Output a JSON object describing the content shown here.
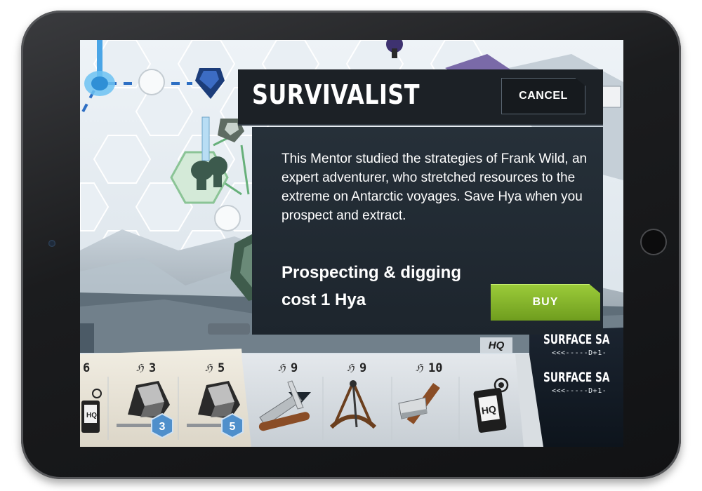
{
  "dialog": {
    "title": "SURVIVALIST",
    "cancel_label": "CANCEL",
    "description": "This Mentor studied the strategies of Frank Wild, an expert adventurer, who stretched resources to the extreme on Antarctic voyages. Save Hya when you prospect and extract.",
    "effect_line1": "Prospecting & digging",
    "effect_line2": "cost 1 Hya",
    "buy_label": "BUY"
  },
  "shop": {
    "hq_label": "HQ",
    "currency_glyph": "ℌ",
    "items": [
      {
        "name": "hq-radio-partial",
        "price": "6",
        "icon": "radio-icon"
      },
      {
        "name": "ore-crystal-level-3",
        "price": "3",
        "icon": "ore-icon",
        "level": "3"
      },
      {
        "name": "ore-crystal-level-5",
        "price": "5",
        "icon": "ore-icon",
        "level": "5"
      },
      {
        "name": "pocket-knife",
        "price": "9",
        "icon": "knife-icon"
      },
      {
        "name": "sextant",
        "price": "9",
        "icon": "sextant-icon"
      },
      {
        "name": "hammer",
        "price": "10",
        "icon": "hammer-icon"
      },
      {
        "name": "hq-radio",
        "price": "",
        "icon": "radio-icon"
      }
    ]
  },
  "surface": {
    "label_1": "SURFACE SA",
    "track_1": "<<<-----D+1-",
    "label_2": "SURFACE SA",
    "track_2": "<<<-----D+1-"
  },
  "colors": {
    "dialog_bg": "#1d252d",
    "buy_green": "#86b52c",
    "badge_blue": "#4f8fcb"
  }
}
